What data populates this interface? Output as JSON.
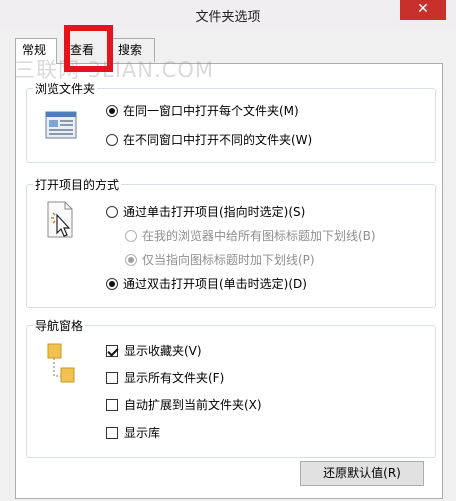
{
  "window": {
    "title": "文件夹选项",
    "close_glyph": "✕"
  },
  "tabs": [
    {
      "label": "常规"
    },
    {
      "label": "查看"
    },
    {
      "label": "搜索"
    }
  ],
  "watermark": "三联网 3LIAN.COM",
  "browse_group": {
    "title": "浏览文件夹",
    "options": [
      {
        "label": "在同一窗口中打开每个文件夹(M)",
        "checked": true
      },
      {
        "label": "在不同窗口中打开不同的文件夹(W)",
        "checked": false
      }
    ]
  },
  "open_group": {
    "title": "打开项目的方式",
    "options": [
      {
        "label": "通过单击打开项目(指向时选定)(S)",
        "checked": false
      },
      {
        "label": "在我的浏览器中给所有图标标题加下划线(B)",
        "checked": false,
        "disabled": true
      },
      {
        "label": "仅当指向图标标题时加下划线(P)",
        "checked": true,
        "disabled": true
      },
      {
        "label": "通过双击打开项目(单击时选定)(D)",
        "checked": true
      }
    ]
  },
  "nav_group": {
    "title": "导航窗格",
    "options": [
      {
        "label": "显示收藏夹(V)",
        "checked": true
      },
      {
        "label": "显示所有文件夹(F)",
        "checked": false
      },
      {
        "label": "自动扩展到当前文件夹(X)",
        "checked": false
      },
      {
        "label": "显示库",
        "checked": false
      }
    ]
  },
  "restore_button": "还原默认值(R)",
  "colors": {
    "highlight": "#e3141d",
    "close": "#c7302b"
  }
}
